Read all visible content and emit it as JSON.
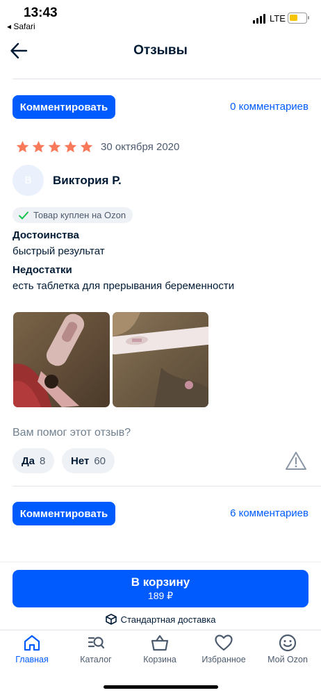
{
  "status_bar": {
    "time": "13:43",
    "back_app": "◂ Safari",
    "network": "LTE"
  },
  "header": {
    "title": "Отзывы"
  },
  "top_actions": {
    "comment_label": "Комментировать",
    "comments_count": "0 комментариев"
  },
  "review": {
    "rating": 5,
    "date": "30 октября 2020",
    "avatar_letter": "В",
    "author": "Виктория Р.",
    "verified_label": "Товар куплен на Ozon",
    "pros_title": "Достоинства",
    "pros_text": "быстрый результат",
    "cons_title": "Недостатки",
    "cons_text": "есть таблетка для прерывания беременности",
    "photos": [
      "photo-1",
      "photo-2"
    ]
  },
  "helpful": {
    "question": "Вам помог этот отзыв?",
    "yes_label": "Да",
    "yes_count": "8",
    "no_label": "Нет",
    "no_count": "60"
  },
  "bottom_actions": {
    "comment_label": "Комментировать",
    "comments_count": "6 комментариев"
  },
  "cart": {
    "label": "В корзину",
    "price": "189 ₽"
  },
  "delivery": {
    "label": "Стандартная доставка"
  },
  "tabbar": [
    {
      "label": "Главная",
      "icon": "home-icon",
      "active": true
    },
    {
      "label": "Каталог",
      "icon": "catalog-search-icon",
      "active": false
    },
    {
      "label": "Корзина",
      "icon": "basket-icon",
      "active": false
    },
    {
      "label": "Избранное",
      "icon": "heart-icon",
      "active": false
    },
    {
      "label": "Мой Ozon",
      "icon": "smiley-icon",
      "active": false
    }
  ],
  "colors": {
    "accent": "#005bff",
    "star": "#f97a5b",
    "verified_check": "#10c44c"
  }
}
